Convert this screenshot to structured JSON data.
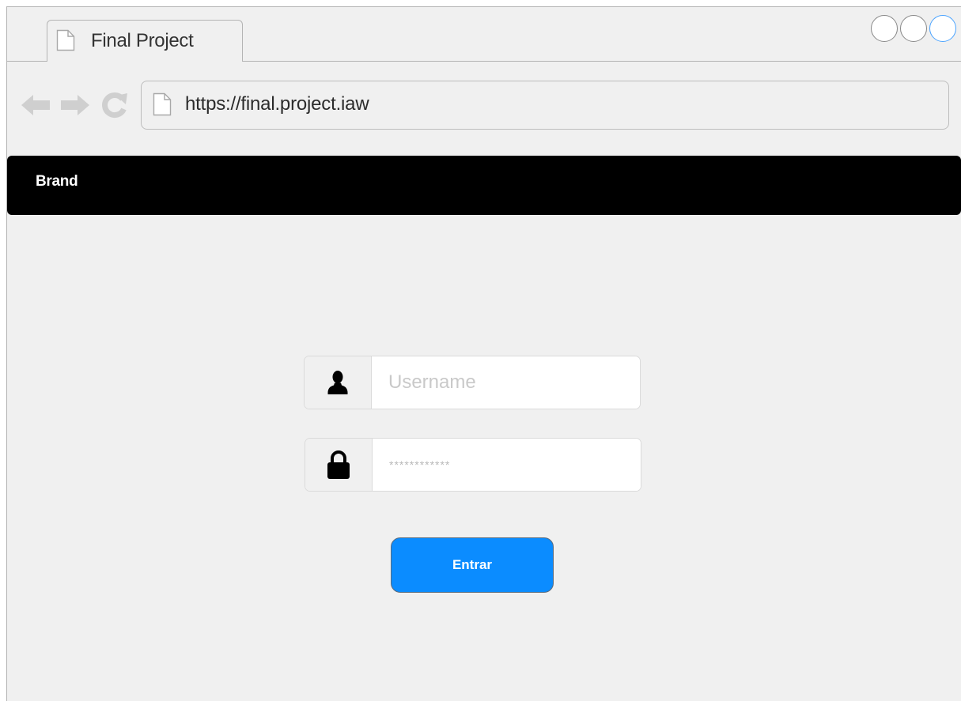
{
  "browser": {
    "tab_title": "Final Project",
    "url": "https://final.project.iaw",
    "icons": {
      "tab_doc": "document-icon",
      "url_doc": "document-icon",
      "back": "arrow-left-icon",
      "forward": "arrow-right-icon",
      "reload": "reload-icon"
    },
    "window_controls": [
      "circle",
      "circle",
      "circle-active"
    ]
  },
  "navbar": {
    "brand": "Brand",
    "background": "#000000"
  },
  "login": {
    "username_placeholder": "Username",
    "username_icon": "user-icon",
    "password_placeholder": "************",
    "password_icon": "lock-icon",
    "submit_label": "Entrar",
    "accent_color": "#0b8cff"
  }
}
